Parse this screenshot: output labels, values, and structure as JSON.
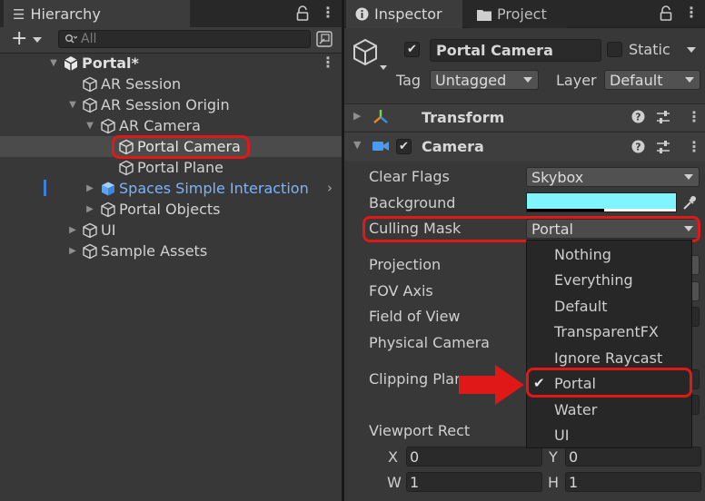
{
  "hierarchy": {
    "tab_label": "Hierarchy",
    "search_placeholder": "All",
    "scene_name": "Portal*",
    "items": [
      {
        "label": "AR Session"
      },
      {
        "label": "AR Session Origin"
      },
      {
        "label": "AR Camera"
      },
      {
        "label": "Portal Camera"
      },
      {
        "label": "Portal Plane"
      },
      {
        "label": "Spaces Simple Interaction"
      },
      {
        "label": "Portal Objects"
      },
      {
        "label": "UI"
      },
      {
        "label": "Sample Assets"
      }
    ]
  },
  "inspector": {
    "tab_label": "Inspector",
    "project_tab_label": "Project",
    "object_name": "Portal Camera",
    "static_label": "Static",
    "tag_label": "Tag",
    "tag_value": "Untagged",
    "layer_label": "Layer",
    "layer_value": "Default",
    "components": {
      "transform": "Transform",
      "camera": "Camera"
    },
    "properties": {
      "clear_flags_label": "Clear Flags",
      "clear_flags_value": "Skybox",
      "background_label": "Background",
      "culling_mask_label": "Culling Mask",
      "culling_mask_value": "Portal",
      "projection_label": "Projection",
      "fov_axis_label": "FOV Axis",
      "field_of_view_label": "Field of View",
      "physical_camera_label": "Physical Camera",
      "clipping_planes_label": "Clipping Planes",
      "viewport_rect_label": "Viewport Rect",
      "x_label": "X",
      "x_value": "0",
      "y_label": "Y",
      "y_value": "0",
      "w_label": "W",
      "w_value": "1",
      "h_label": "H",
      "h_value": "1"
    },
    "culling_menu": {
      "options": [
        "Nothing",
        "Everything",
        "Default",
        "TransparentFX",
        "Ignore Raycast",
        "Portal",
        "Water",
        "UI"
      ],
      "checked": "Portal"
    }
  },
  "colors": {
    "background_swatch": "#7FF5FF",
    "highlight_red": "#E01818",
    "prefab_blue": "#7AB4FF"
  }
}
